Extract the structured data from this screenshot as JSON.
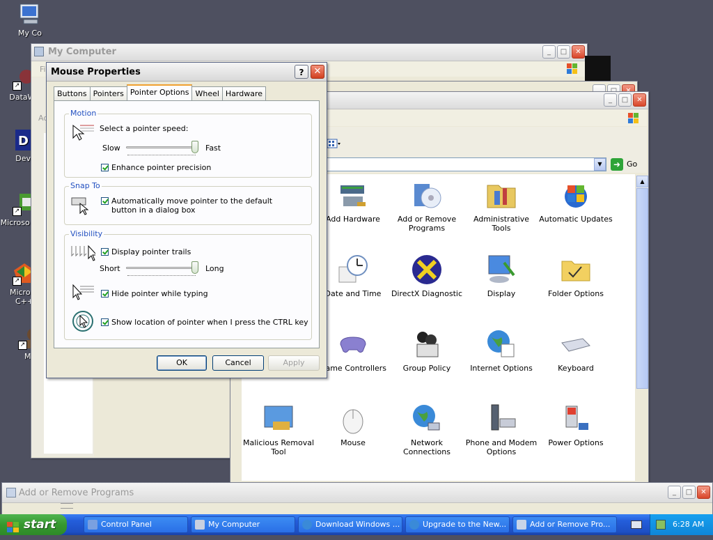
{
  "desktop": {
    "icons": [
      {
        "label": "My Co"
      },
      {
        "label": "DataWa"
      },
      {
        "label": "Dev-"
      },
      {
        "label": "Microso Basi"
      },
      {
        "label": "Microso C++"
      },
      {
        "label": "My"
      }
    ]
  },
  "windows": {
    "my_computer": {
      "title": "My Computer",
      "menu_letter": "Fi",
      "side_text": "Ad"
    },
    "control_panel": {
      "go_label": "Go"
    },
    "add_remove": {
      "title": "Add or Remove Programs"
    }
  },
  "control_panel": {
    "items": [
      {
        "label": "Add Hardware",
        "icon": "add-hardware-icon"
      },
      {
        "label": "Add or Remove Programs",
        "icon": "add-remove-programs-icon"
      },
      {
        "label": "Administrative Tools",
        "icon": "administrative-tools-icon"
      },
      {
        "label": "Automatic Updates",
        "icon": "automatic-updates-icon"
      },
      {
        "label": "Date and Time",
        "icon": "date-time-icon"
      },
      {
        "label": "DirectX Diagnostic",
        "icon": "directx-icon"
      },
      {
        "label": "Display",
        "icon": "display-icon"
      },
      {
        "label": "Folder Options",
        "icon": "folder-options-icon"
      },
      {
        "label": "Game Controllers",
        "icon": "game-controllers-icon"
      },
      {
        "label": "Group Policy",
        "icon": "group-policy-icon"
      },
      {
        "label": "Internet Options",
        "icon": "internet-options-icon"
      },
      {
        "label": "Keyboard",
        "icon": "keyboard-icon"
      },
      {
        "label": "Malicious Removal Tool",
        "icon": "malicious-removal-icon"
      },
      {
        "label": "Mouse",
        "icon": "mouse-icon"
      },
      {
        "label": "Network Connections",
        "icon": "network-connections-icon"
      },
      {
        "label": "Phone and Modem Options",
        "icon": "phone-modem-icon"
      },
      {
        "label": "Power Options",
        "icon": "power-options-icon"
      }
    ]
  },
  "dialog": {
    "title": "Mouse Properties",
    "help": "?",
    "tabs": [
      "Buttons",
      "Pointers",
      "Pointer Options",
      "Wheel",
      "Hardware"
    ],
    "active_tab": "Pointer Options",
    "motion": {
      "legend": "Motion",
      "speed_label": "Select a pointer speed:",
      "slow": "Slow",
      "fast": "Fast",
      "speed_level": 1.0,
      "enhance_label": "Enhance pointer precision",
      "enhance_checked": true
    },
    "snap_to": {
      "legend": "Snap To",
      "label": "Automatically move pointer to the default button in a dialog box",
      "checked": true
    },
    "visibility": {
      "legend": "Visibility",
      "trails_label": "Display pointer trails",
      "trails_checked": true,
      "short": "Short",
      "long": "Long",
      "trail_level": 1.0,
      "hide_label": "Hide pointer while typing",
      "hide_checked": true,
      "ctrl_label": "Show location of pointer when I press the CTRL key",
      "ctrl_checked": true
    },
    "buttons": {
      "ok": "OK",
      "cancel": "Cancel",
      "apply": "Apply"
    }
  },
  "taskbar": {
    "start_label": "start",
    "items": [
      {
        "label": "Control Panel"
      },
      {
        "label": "My Computer"
      },
      {
        "label": "Download Windows ..."
      },
      {
        "label": "Upgrade to the New..."
      },
      {
        "label": "Add or Remove Pro..."
      }
    ],
    "clock": "6:28 AM"
  }
}
